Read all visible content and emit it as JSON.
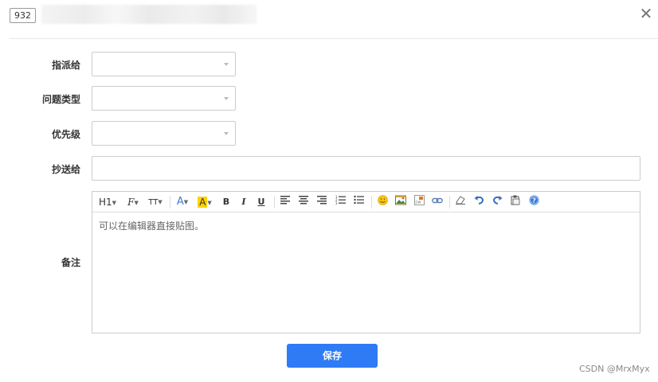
{
  "header": {
    "id_badge": "932",
    "close_icon": "close-icon"
  },
  "form": {
    "assignee_label": "指派给",
    "issue_type_label": "问题类型",
    "priority_label": "优先级",
    "cc_label": "抄送给",
    "cc_value": "",
    "notes_label": "备注"
  },
  "editor": {
    "toolbar": {
      "heading": "H1",
      "font_family": "F",
      "font_size": "TT",
      "font_color": "A",
      "bg_color": "A",
      "bold": "B",
      "italic": "I",
      "underline": "U"
    },
    "placeholder": "可以在编辑器直接贴图。"
  },
  "actions": {
    "save_label": "保存"
  },
  "watermark": "CSDN @MrxMyx",
  "colors": {
    "primary": "#2f7bf5",
    "border": "#cccccc"
  }
}
